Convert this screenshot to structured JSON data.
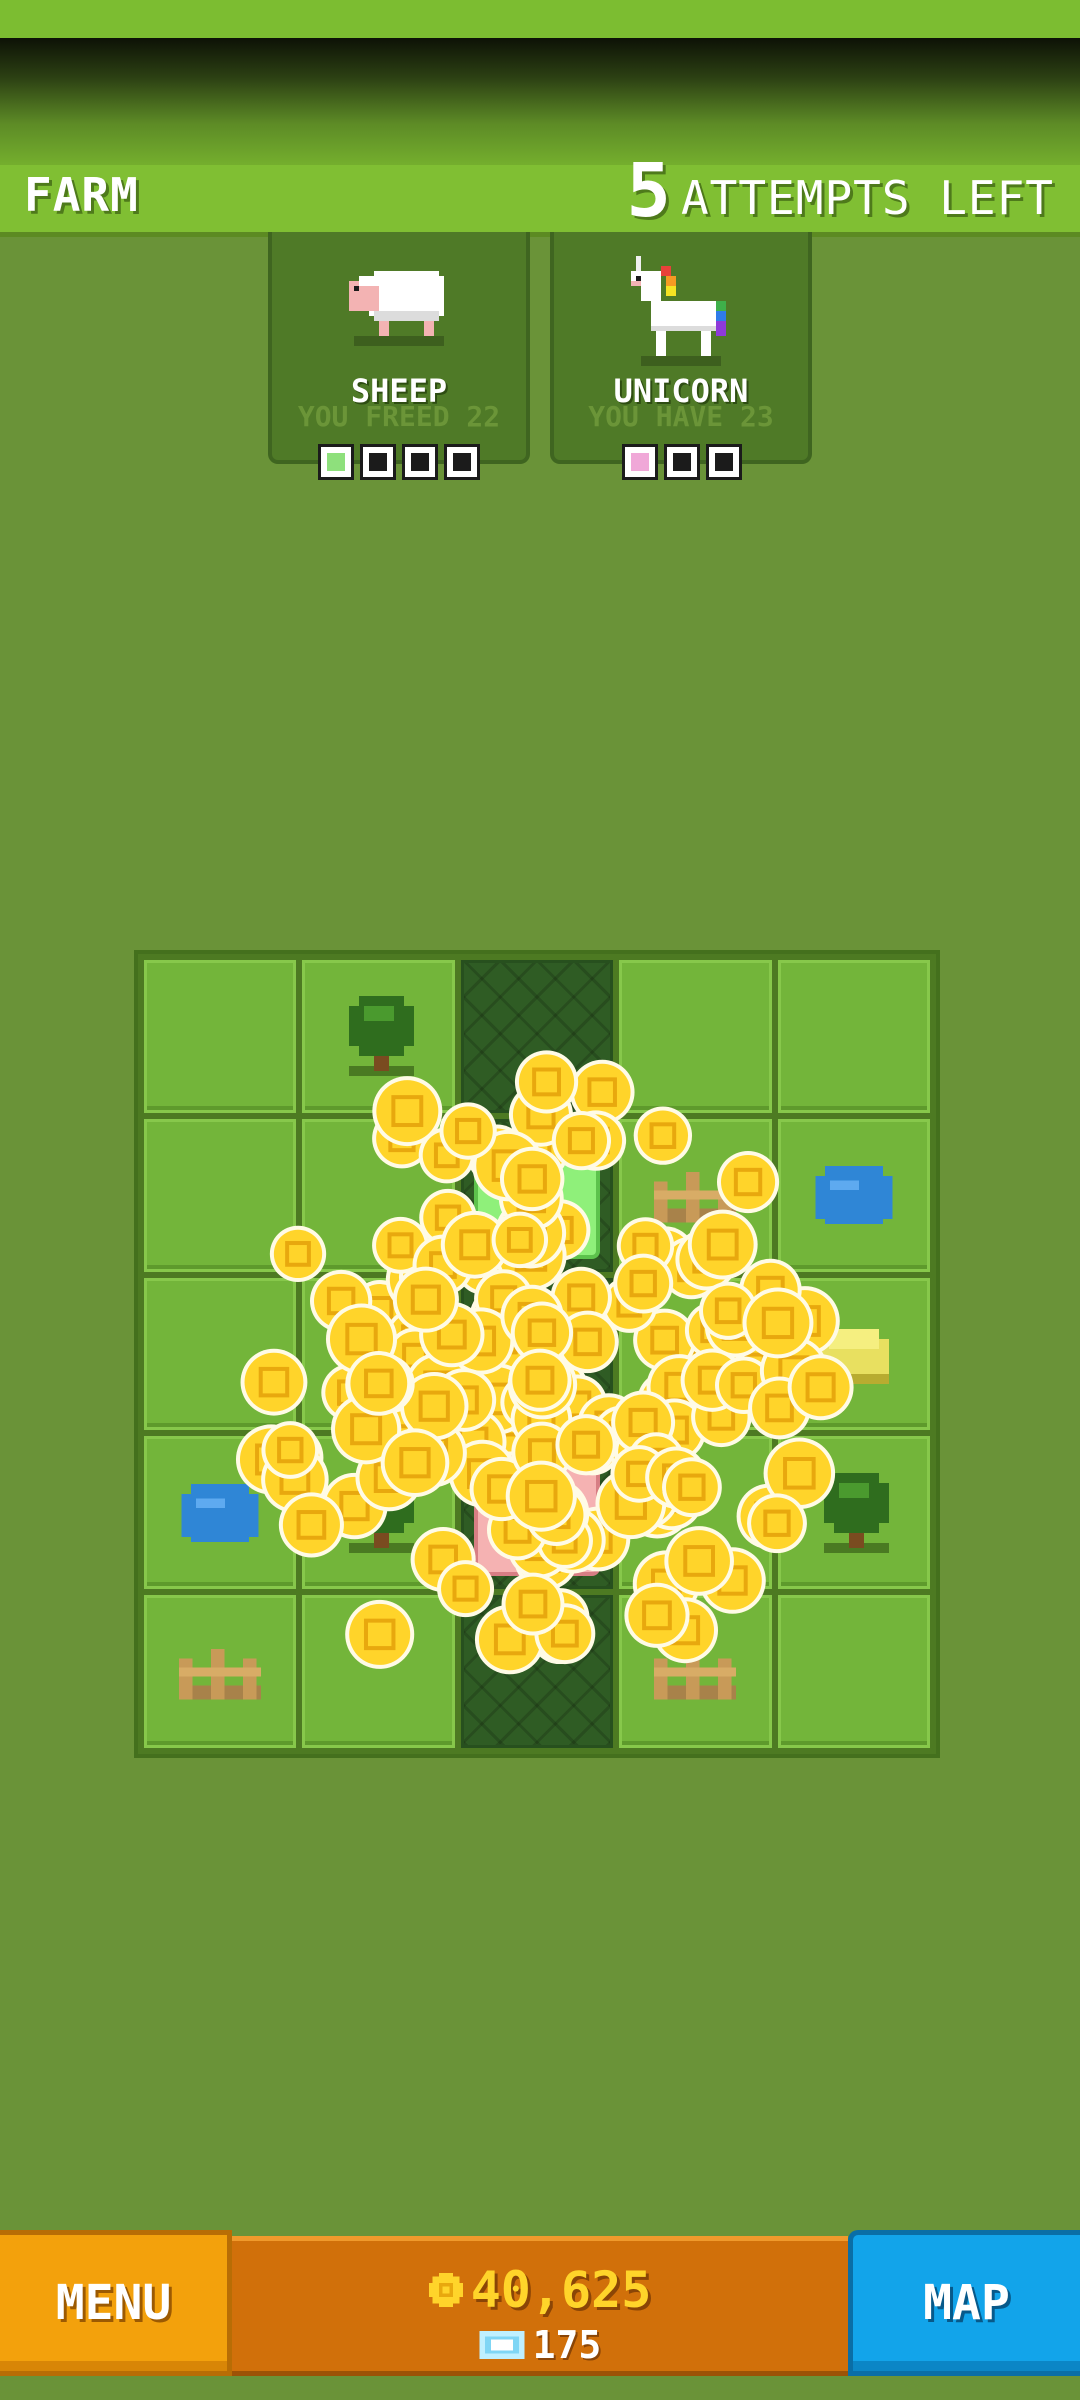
{
  "header": {
    "level_name": "FARM",
    "attempts_count": "5",
    "attempts_label": "ATTEMPTS LEFT"
  },
  "animals": [
    {
      "name": "SHEEP",
      "ghost_text": "YOU FREED 22",
      "icon": "sheep-icon",
      "slots_total": 4,
      "slots_filled": 1,
      "fill_color": "#8ee07c"
    },
    {
      "name": "UNICORN",
      "ghost_text": "YOU HAVE 23",
      "icon": "unicorn-icon",
      "slots_total": 3,
      "slots_filled": 1,
      "fill_color": "#f0a8d8"
    }
  ],
  "board": {
    "rows": 5,
    "cols": 5,
    "tiles": [
      [
        "grass",
        "tree",
        "path",
        "grass",
        "grass"
      ],
      [
        "grass",
        "grass",
        "pad-green",
        "fence",
        "pond"
      ],
      [
        "grass",
        "grass",
        "path",
        "grass",
        "hay"
      ],
      [
        "pond",
        "tree",
        "pad-pink",
        "grass",
        "tree"
      ],
      [
        "fence",
        "grass",
        "path",
        "fence",
        "grass"
      ]
    ]
  },
  "currency": {
    "coins": "40,625",
    "gems": "175",
    "coin_icon": "coin-icon",
    "gem_icon": "gem-icon"
  },
  "buttons": {
    "menu_label": "MENU",
    "map_label": "MAP"
  },
  "colors": {
    "background": "#6a9338",
    "header": "#80bf33",
    "menu": "#f3a10c",
    "map": "#12a4ea",
    "coin": "#ffd42a"
  }
}
